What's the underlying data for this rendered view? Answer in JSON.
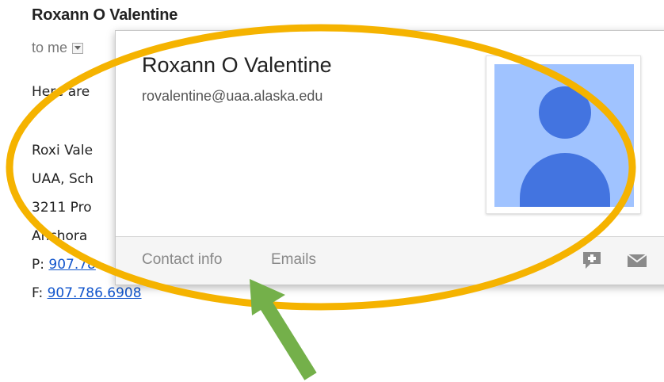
{
  "email": {
    "sender_name": "Roxann O Valentine",
    "to_label": "to me",
    "body_lines": [
      "Here are",
      "",
      "Roxi Vale",
      "UAA, Sch",
      "3211 Pro",
      "Anchora"
    ],
    "phone_prefix": "P:",
    "phone_partial": "907.78",
    "fax_prefix": "F:",
    "fax_partial": "907.786.6908"
  },
  "contact_card": {
    "name": "Roxann O Valentine",
    "email": "rovalentine@uaa.alaska.edu",
    "footer_links": [
      "Contact info",
      "Emails"
    ],
    "icons": [
      "add-chat-icon",
      "mail-icon"
    ]
  },
  "annotation": {
    "highlight_color": "#f5b300",
    "arrow_color": "#74b04a"
  }
}
